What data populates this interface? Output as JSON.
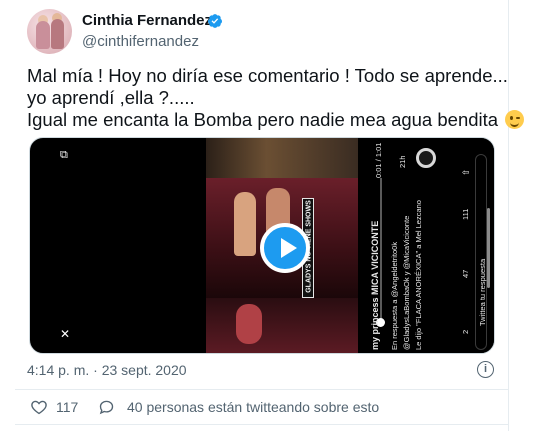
{
  "author": {
    "name": "Cinthia Fernandez",
    "handle": "@cinthifernandez",
    "verified": true
  },
  "tweet": {
    "lines": [
      "Mal mía ! Hoy no diría ese comentario ! Todo se aprende...",
      "yo aprendí ,ella ?.....",
      "Igual me encanta la Bomba pero nadie mea agua bendita"
    ],
    "emoji": "winking-face-emoji"
  },
  "media": {
    "type": "video",
    "caption_text": "GLADYS NO TIENE SHOWS",
    "side_panel": {
      "account": "my princess MICA VICICONTE",
      "reply_to": "En respuesta a @Angeldetrito0k",
      "mentions": "@GladysLaBombaOk y @MicaViciconte",
      "quote": "Le dijo \"FLACA ANORÉXICA\" a Mel Lezcano",
      "time_label": "21h",
      "likes": "111",
      "retweets": "47",
      "comments": "2",
      "reply_placeholder": "Twittea tu respuesta",
      "timecode": "0:01 / 1:01"
    }
  },
  "meta": {
    "timestamp": "4:14 p. m. · 23 sept. 2020"
  },
  "actions": {
    "like_count": "117",
    "conversation_text": "40 personas están twitteando sobre esto"
  },
  "colors": {
    "accent": "#1d9bf0",
    "secondary_text": "#536471",
    "divider": "#e6ecf0"
  }
}
